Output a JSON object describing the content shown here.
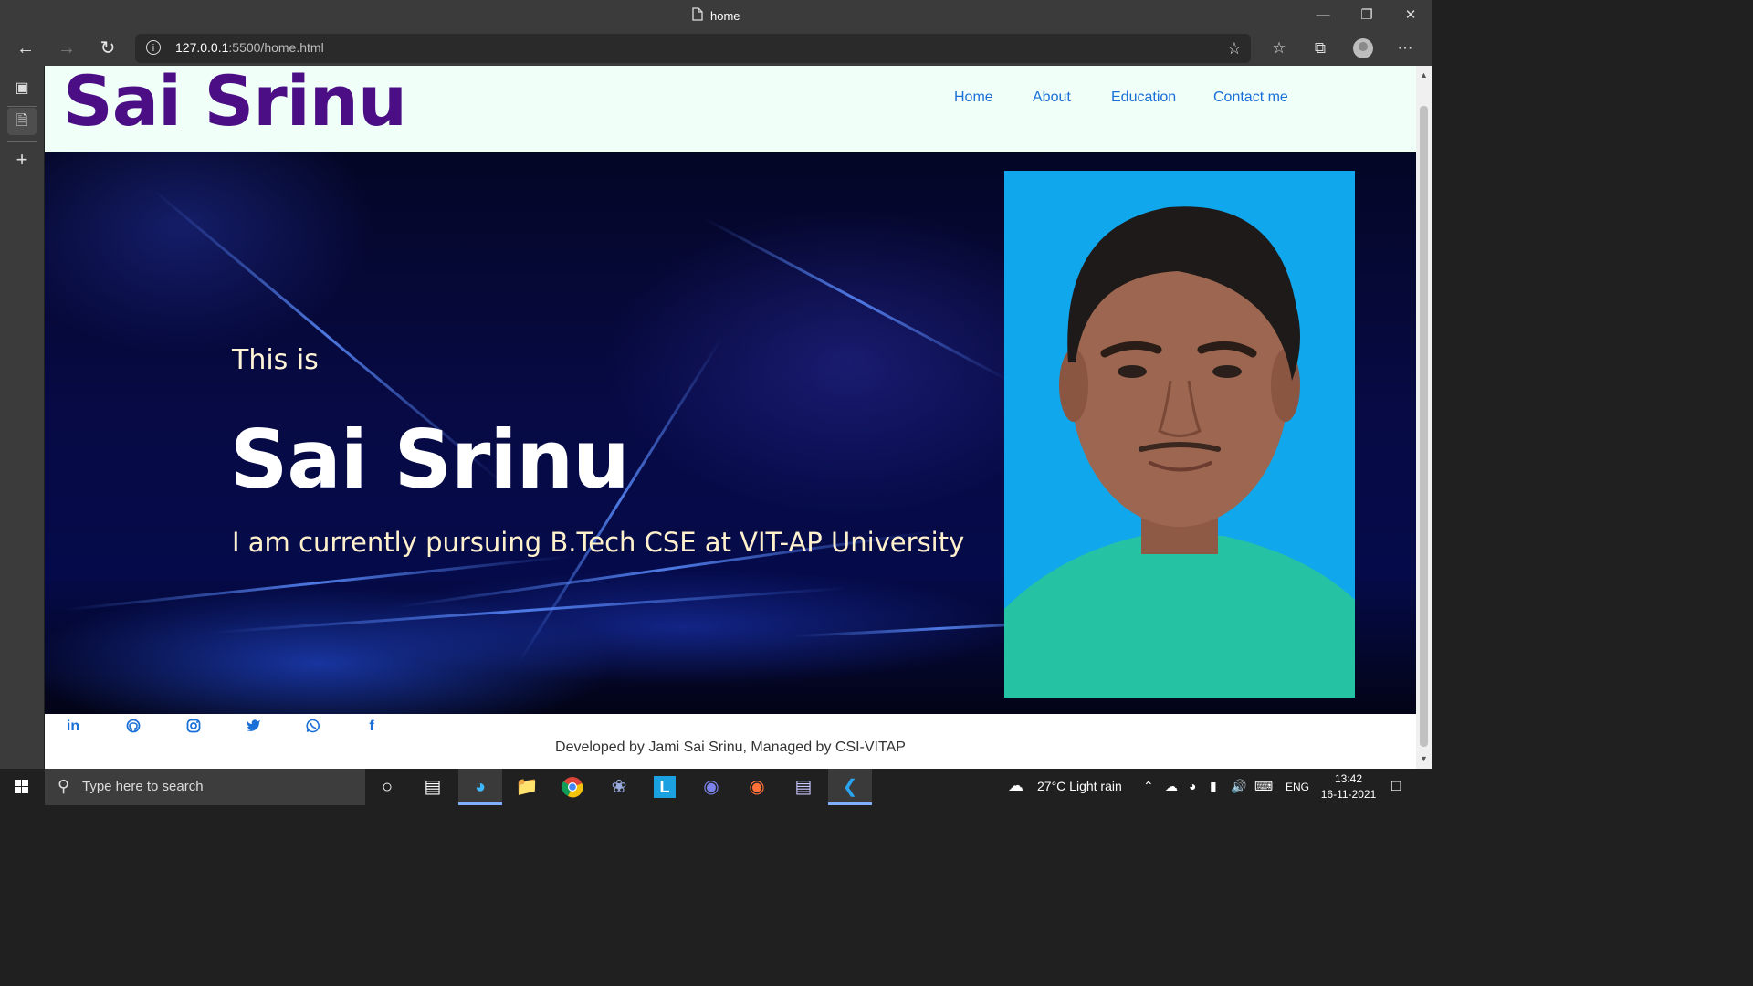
{
  "browser": {
    "tab_title": "home",
    "url_host": "127.0.0.1",
    "url_rest": ":5500/home.html"
  },
  "site": {
    "logo": "Sai Srinu",
    "nav": [
      "Home",
      "About",
      "Education",
      "Contact me"
    ],
    "hero": {
      "intro": "This is",
      "name": "Sai Srinu",
      "tagline": "I am currently pursuing B.Tech CSE at VIT-AP University"
    },
    "footer": {
      "credit": "Developed by Jami Sai Srinu, Managed by CSI-VITAP"
    }
  },
  "taskbar": {
    "search_placeholder": "Type here to search",
    "weather": "27°C  Light rain",
    "language": "ENG",
    "time": "13:42",
    "date": "16-11-2021"
  }
}
